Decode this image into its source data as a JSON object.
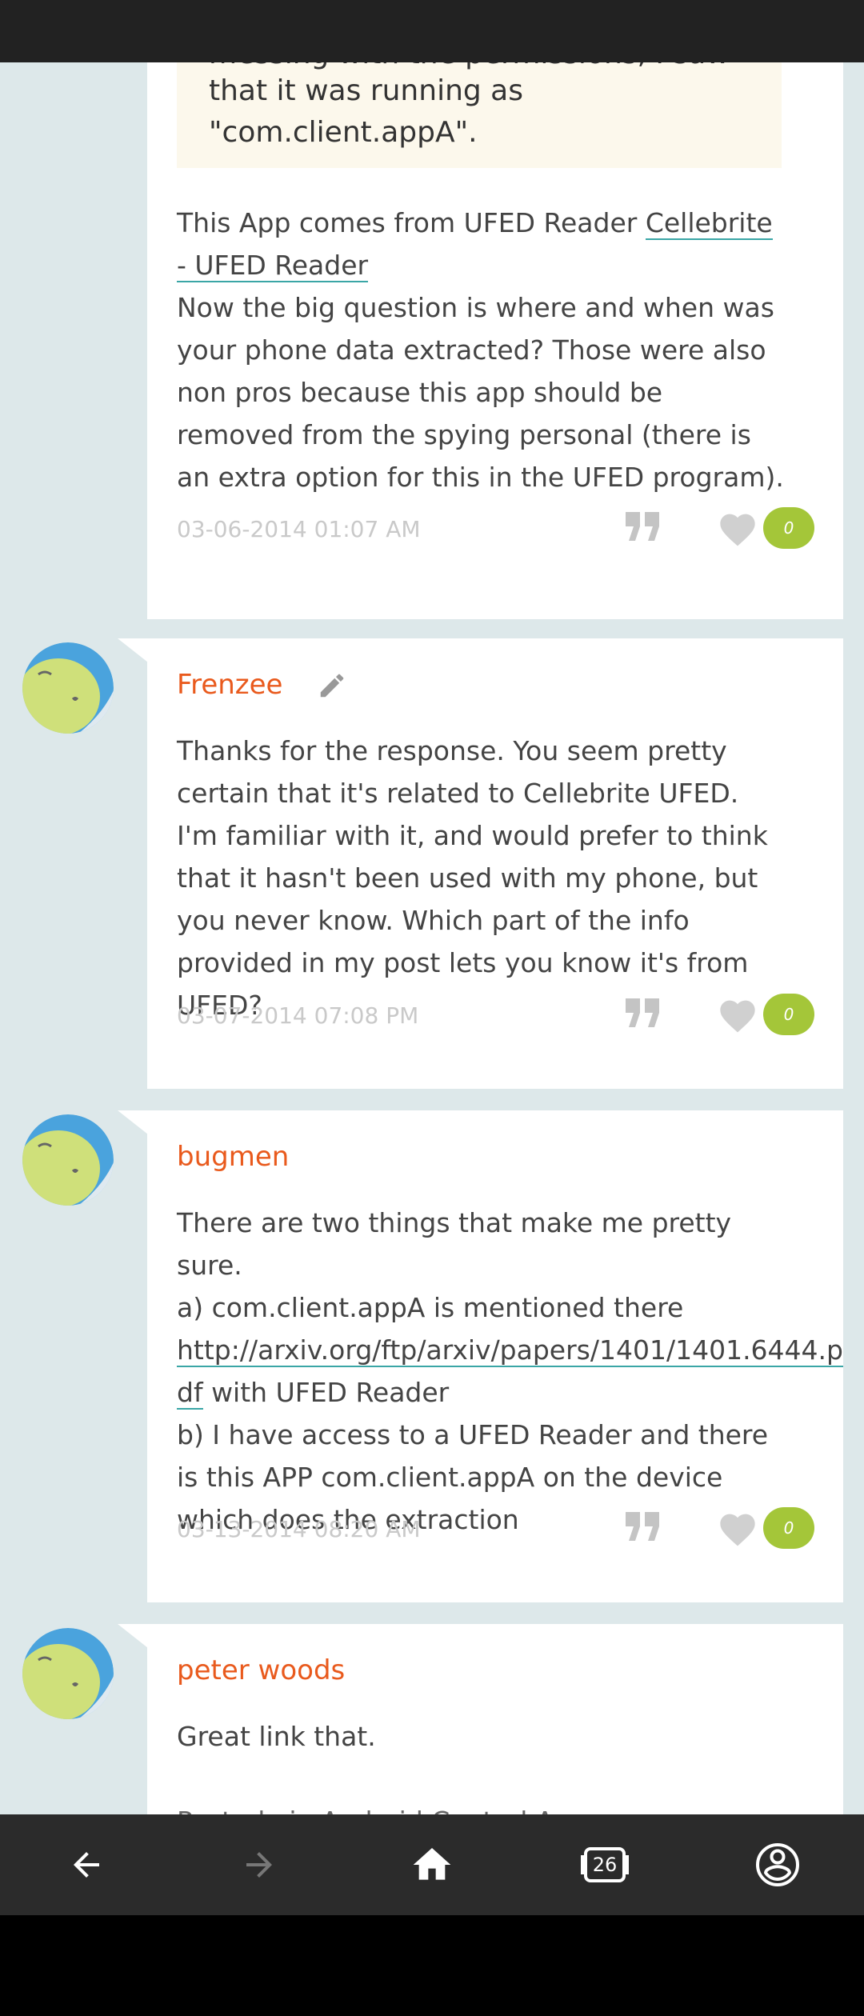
{
  "colors": {
    "accent": "#e95a1d",
    "link_underline": "#3aa6a6",
    "like_badge": "#a4c639",
    "background": "#dde8ea"
  },
  "post1": {
    "quote_partial": "messing with the permissions, I saw",
    "quote_line1": "that it was running as",
    "quote_line2": "\"com.client.appA\".",
    "body_pre": "This App comes from UFED Reader ",
    "body_link": "Cellebrite - UFED Reader",
    "body_post": "Now the big question is where and when was your phone data extracted? Those were also non pros because this app should be removed from the spying personal (there is an extra option for this in the UFED program).",
    "date": "03-06-2014 01:07 AM",
    "likes": "0"
  },
  "post2": {
    "author": "Frenzee",
    "body": "Thanks for the response. You seem pretty certain that it's related to Cellebrite UFED. I'm familiar with it, and would prefer to think that it hasn't been used with my phone, but you never know. Which part of the info provided in my post lets you know it's from UFED?",
    "date": "03-07-2014 07:08 PM",
    "likes": "0"
  },
  "post3": {
    "author": "bugmen",
    "line1": "There are two things that make me pretty sure.",
    "line2": "a) com.client.appA is mentioned there",
    "link_part1": "http://arxiv.org/ftp/arxiv/papers/1401/1401.6444.p",
    "link_part2": "df",
    "after_link": " with UFED Reader",
    "line4": "b) I have access to a UFED Reader and there is this APP com.client.appA on the device which does the extraction",
    "date": "03-13-2014 08:20 AM",
    "likes": "0"
  },
  "post4": {
    "author": "peter woods",
    "body": "Great link that.",
    "partial": "Posted via Android Central App"
  },
  "nav": {
    "tabs_count": "26",
    "back_icon": "arrow-left-icon",
    "forward_icon": "arrow-right-icon",
    "home_icon": "home-icon",
    "tabs_icon": "tabs-icon",
    "account_icon": "account-icon"
  }
}
